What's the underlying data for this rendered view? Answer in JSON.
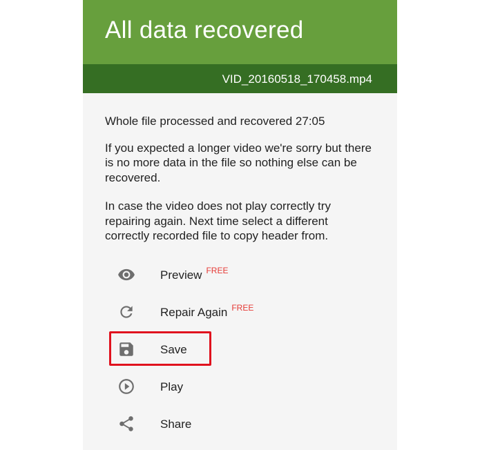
{
  "header": {
    "title": "All data recovered"
  },
  "subbar": {
    "filename": "VID_20160518_170458.mp4"
  },
  "content": {
    "paragraphs": [
      "Whole file processed and recovered 27:05",
      "If you expected a longer video we're sorry but there is no more data in the file so nothing else can be recovered.",
      "In case the video does not play correctly try repairing again. Next time select a different correctly recorded file to copy header from."
    ]
  },
  "actions": [
    {
      "label": "Preview",
      "badge": "FREE",
      "icon": "eye-icon"
    },
    {
      "label": "Repair Again",
      "badge": "FREE",
      "icon": "refresh-icon"
    },
    {
      "label": "Save",
      "badge": "",
      "icon": "save-icon"
    },
    {
      "label": "Play",
      "badge": "",
      "icon": "play-circle-icon"
    },
    {
      "label": "Share",
      "badge": "",
      "icon": "share-icon"
    }
  ],
  "colors": {
    "header": "#679f3d",
    "subbar": "#356e23",
    "badge": "#e53935",
    "highlight": "#e0121e",
    "icon": "#6e6e6e"
  }
}
